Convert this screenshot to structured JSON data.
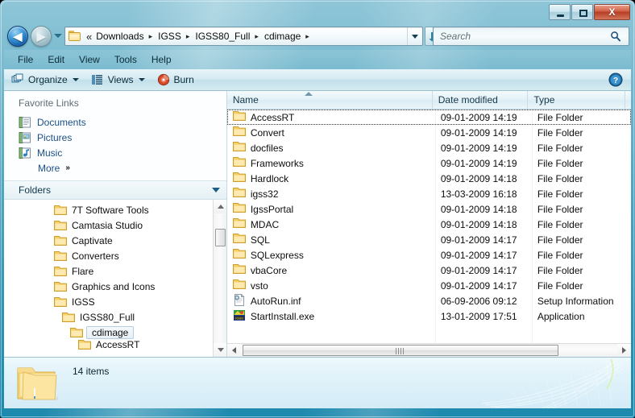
{
  "window": {
    "title": "",
    "caption_buttons": {
      "minimize": "minimize",
      "maximize": "maximize",
      "close": "X"
    }
  },
  "navigation": {
    "back_label": "◀",
    "forward_label": "▶",
    "history_dropdown": "recent-locations",
    "refresh_label": "refresh"
  },
  "address": {
    "folder_icon": "folder-icon",
    "overflow": "«",
    "crumbs": [
      {
        "label": "Downloads"
      },
      {
        "label": "IGSS"
      },
      {
        "label": "IGSS80_Full"
      },
      {
        "label": "cdimage"
      }
    ],
    "separator": "▸",
    "dropdown": "address-dropdown"
  },
  "search": {
    "placeholder": "Search",
    "value": ""
  },
  "menubar": {
    "items": [
      {
        "label": "File"
      },
      {
        "label": "Edit"
      },
      {
        "label": "View"
      },
      {
        "label": "Tools"
      },
      {
        "label": "Help"
      }
    ]
  },
  "toolbar": {
    "organize_label": "Organize",
    "views_label": "Views",
    "burn_label": "Burn",
    "help_label": "?"
  },
  "sidebar": {
    "favorites_title": "Favorite Links",
    "favorites": [
      {
        "label": "Documents",
        "icon": "documents-icon"
      },
      {
        "label": "Pictures",
        "icon": "pictures-icon"
      },
      {
        "label": "Music",
        "icon": "music-icon"
      }
    ],
    "more_label": "More",
    "more_chevron": "»",
    "folders_label": "Folders",
    "tree": [
      {
        "label": "7T Software Tools",
        "depth": 1,
        "selected": false
      },
      {
        "label": "Camtasia Studio",
        "depth": 1,
        "selected": false
      },
      {
        "label": "Captivate",
        "depth": 1,
        "selected": false
      },
      {
        "label": "Converters",
        "depth": 1,
        "selected": false
      },
      {
        "label": "Flare",
        "depth": 1,
        "selected": false
      },
      {
        "label": "Graphics and Icons",
        "depth": 1,
        "selected": false
      },
      {
        "label": "IGSS",
        "depth": 1,
        "selected": false
      },
      {
        "label": "IGSS80_Full",
        "depth": 2,
        "selected": false
      },
      {
        "label": "cdimage",
        "depth": 3,
        "selected": true
      },
      {
        "label": "AccessRT",
        "depth": 4,
        "selected": false
      }
    ]
  },
  "filelist": {
    "columns": [
      {
        "label": "Name",
        "key": "name"
      },
      {
        "label": "Date modified",
        "key": "date"
      },
      {
        "label": "Type",
        "key": "type"
      }
    ],
    "sort_column": "Name",
    "sort_direction": "ascending",
    "rows": [
      {
        "name": "AccessRT",
        "date": "09-01-2009 14:19",
        "type": "File Folder",
        "icon": "folder-icon",
        "focused": true
      },
      {
        "name": "Convert",
        "date": "09-01-2009 14:19",
        "type": "File Folder",
        "icon": "folder-icon",
        "focused": false
      },
      {
        "name": "docfiles",
        "date": "09-01-2009 14:19",
        "type": "File Folder",
        "icon": "folder-icon",
        "focused": false
      },
      {
        "name": "Frameworks",
        "date": "09-01-2009 14:19",
        "type": "File Folder",
        "icon": "folder-icon",
        "focused": false
      },
      {
        "name": "Hardlock",
        "date": "09-01-2009 14:18",
        "type": "File Folder",
        "icon": "folder-icon",
        "focused": false
      },
      {
        "name": "igss32",
        "date": "13-03-2009 16:18",
        "type": "File Folder",
        "icon": "folder-icon",
        "focused": false
      },
      {
        "name": "IgssPortal",
        "date": "09-01-2009 14:18",
        "type": "File Folder",
        "icon": "folder-icon",
        "focused": false
      },
      {
        "name": "MDAC",
        "date": "09-01-2009 14:18",
        "type": "File Folder",
        "icon": "folder-icon",
        "focused": false
      },
      {
        "name": "SQL",
        "date": "09-01-2009 14:17",
        "type": "File Folder",
        "icon": "folder-icon",
        "focused": false
      },
      {
        "name": "SQLexpress",
        "date": "09-01-2009 14:17",
        "type": "File Folder",
        "icon": "folder-icon",
        "focused": false
      },
      {
        "name": "vbaCore",
        "date": "09-01-2009 14:17",
        "type": "File Folder",
        "icon": "folder-icon",
        "focused": false
      },
      {
        "name": "vsto",
        "date": "09-01-2009 14:17",
        "type": "File Folder",
        "icon": "folder-icon",
        "focused": false
      },
      {
        "name": "AutoRun.inf",
        "date": "06-09-2006 09:12",
        "type": "Setup Information",
        "icon": "inf-file-icon",
        "focused": false
      },
      {
        "name": "StartInstall.exe",
        "date": "13-01-2009 17:51",
        "type": "Application",
        "icon": "exe-file-icon",
        "focused": false
      }
    ]
  },
  "statusbar": {
    "item_count_label": "14 items",
    "folder_icon": "large-folder-icon"
  },
  "colors": {
    "frame_start": "#8fc6d8",
    "frame_end": "#1d89ae",
    "link_blue": "#1a4f87",
    "folder_yellow": "#f7d064",
    "close_red": "#b63f25",
    "header_blue": "#e4f1f7"
  }
}
